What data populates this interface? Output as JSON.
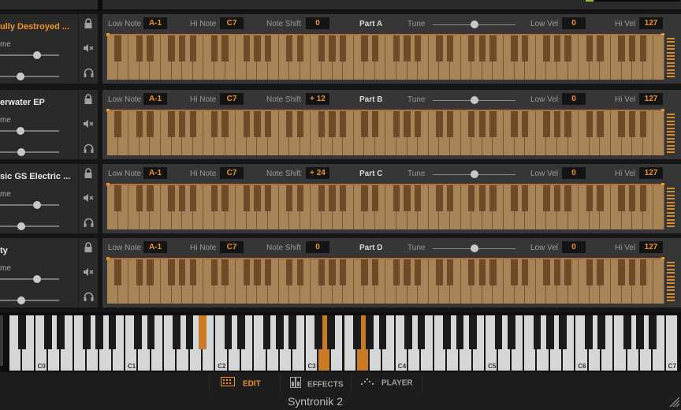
{
  "app": {
    "title": "Syntronik 2"
  },
  "colors": {
    "accent": "#f0922a",
    "keyboard_on": "#c97a24",
    "meter": "#8fc13c"
  },
  "labels": {
    "low_note": "Low Note",
    "hi_note": "Hi Note",
    "note_shift": "Note Shift",
    "tune": "Tune",
    "low_vel": "Low Vel",
    "hi_vel": "Hi Vel",
    "volume_partial": "me"
  },
  "parts": [
    {
      "name": "ully Destroyed ...",
      "active": true,
      "part_label": "Part A",
      "low_note": "A-1",
      "hi_note": "C7",
      "note_shift": "0",
      "low_vel": "0",
      "hi_vel": "127",
      "volume": 0.62,
      "pan": 0.35,
      "tune": 0.5
    },
    {
      "name": "erwater EP",
      "active": false,
      "part_label": "Part B",
      "low_note": "A-1",
      "hi_note": "C7",
      "note_shift": "+ 12",
      "low_vel": "0",
      "hi_vel": "127",
      "volume": 0.34,
      "pan": 0.36,
      "tune": 0.5
    },
    {
      "name": "sic GS Electric ...",
      "active": false,
      "part_label": "Part C",
      "low_note": "A-1",
      "hi_note": "C7",
      "note_shift": "+ 24",
      "low_vel": "0",
      "hi_vel": "127",
      "volume": 0.62,
      "pan": 0.36,
      "tune": 0.5
    },
    {
      "name": "ty",
      "active": false,
      "part_label": "Part D",
      "low_note": "A-1",
      "hi_note": "C7",
      "note_shift": "0",
      "low_vel": "0",
      "hi_vel": "127",
      "volume": 0.62,
      "pan": 0.36,
      "tune": 0.5
    }
  ],
  "side_icons": [
    "lock-icon",
    "mute-icon",
    "headphones-icon"
  ],
  "keyboard": {
    "range_low": "A-1",
    "range_high": "C7",
    "octave_labels": [
      "C0",
      "C1",
      "C2",
      "C3",
      "C4",
      "C5",
      "C6",
      "C7"
    ],
    "pressed_keys": [
      "A#1",
      "D3",
      "G3"
    ]
  },
  "tabs": [
    {
      "label": "EDIT",
      "icon": "edit-grid-icon",
      "active": true
    },
    {
      "label": "EFFECTS",
      "icon": "effects-rack-icon",
      "active": false
    },
    {
      "label": "PLAYER",
      "icon": "player-arp-icon",
      "active": false
    }
  ]
}
